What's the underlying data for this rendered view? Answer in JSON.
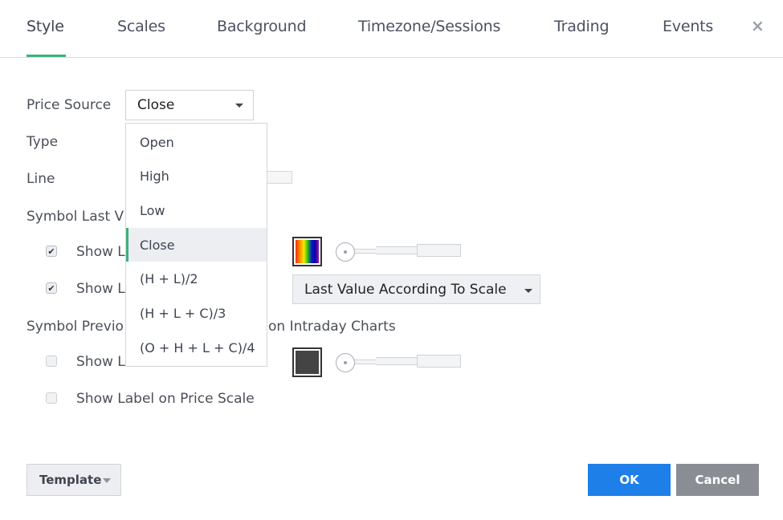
{
  "tabs": [
    {
      "label": "Style",
      "active": true
    },
    {
      "label": "Scales",
      "active": false
    },
    {
      "label": "Background",
      "active": false
    },
    {
      "label": "Timezone/Sessions",
      "active": false
    },
    {
      "label": "Trading",
      "active": false
    },
    {
      "label": "Events",
      "active": false
    }
  ],
  "close_label": "×",
  "accent_color": "#3fb07a",
  "style": {
    "price_source_label": "Price Source",
    "price_source_value": "Close",
    "type_label": "Type",
    "line_label": "Line",
    "symbol_last_value_label": "Symbol Last V",
    "show_line_1": {
      "label": "Show L",
      "checked": true
    },
    "show_label_1": {
      "label": "Show L",
      "checked": true
    },
    "last_value_mode": "Last Value According To Scale",
    "symbol_prev_label_left": "Symbol Previo",
    "symbol_prev_label_right": "on Intraday Charts",
    "show_line_2": {
      "label": "Show Line",
      "checked": false
    },
    "show_label_2": {
      "label": "Show Label on Price Scale",
      "checked": false
    },
    "last_value_color": "rainbow-gradient",
    "prev_close_color": "#444444"
  },
  "dropdown": {
    "selected": "Close",
    "options": [
      "Open",
      "High",
      "Low",
      "Close",
      "(H + L)/2",
      "(H + L + C)/3",
      "(O + H + L + C)/4"
    ]
  },
  "footer": {
    "template_label": "Template",
    "ok_label": "OK",
    "cancel_label": "Cancel",
    "ok_color": "#1e7fe8",
    "cancel_color": "#8a8e94"
  }
}
